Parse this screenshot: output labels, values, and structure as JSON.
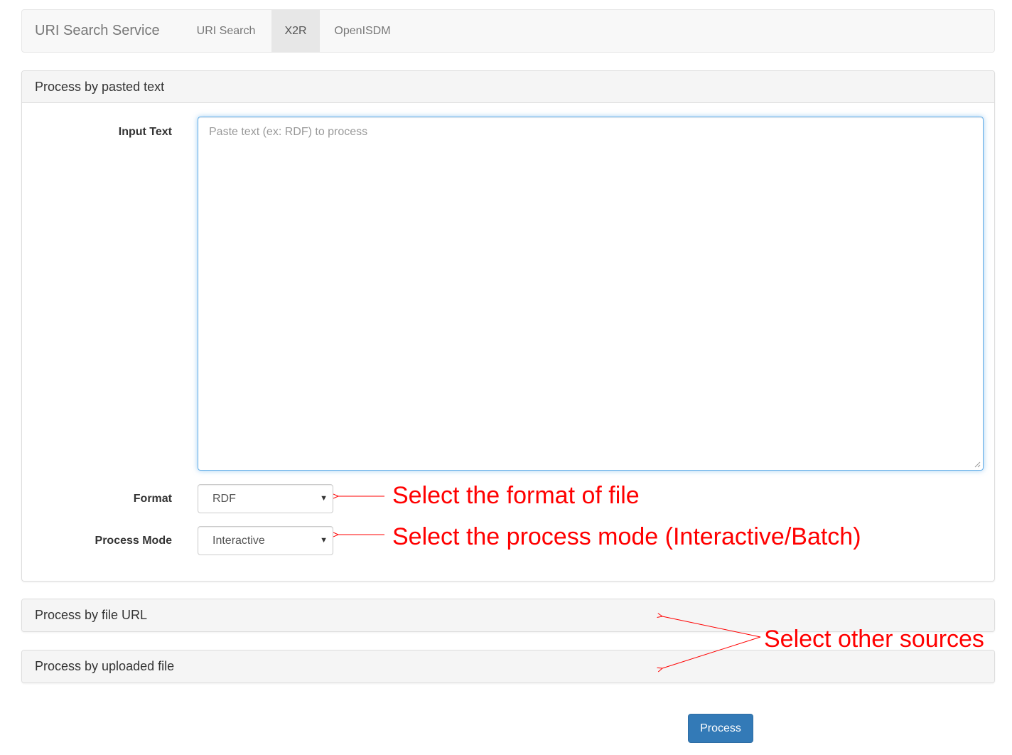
{
  "navbar": {
    "brand": "URI Search Service",
    "items": [
      {
        "label": "URI Search",
        "active": false
      },
      {
        "label": "X2R",
        "active": true
      },
      {
        "label": "OpenISDM",
        "active": false
      }
    ]
  },
  "pasted_panel": {
    "heading": "Process by pasted text",
    "input_text_label": "Input Text",
    "input_text_placeholder": "Paste text (ex: RDF) to process",
    "format_label": "Format",
    "format_value": "RDF",
    "mode_label": "Process Mode",
    "mode_value": "Interactive"
  },
  "other_panels": {
    "url_heading": "Process by file URL",
    "upload_heading": "Process by uploaded file"
  },
  "process_button": "Process",
  "annotations": {
    "format": "Select the format of file",
    "mode": "Select the process mode (Interactive/Batch)",
    "sources": "Select other sources",
    "color": "#ff0000"
  },
  "colors": {
    "accent": "#337ab7",
    "focus": "#66afe9"
  }
}
